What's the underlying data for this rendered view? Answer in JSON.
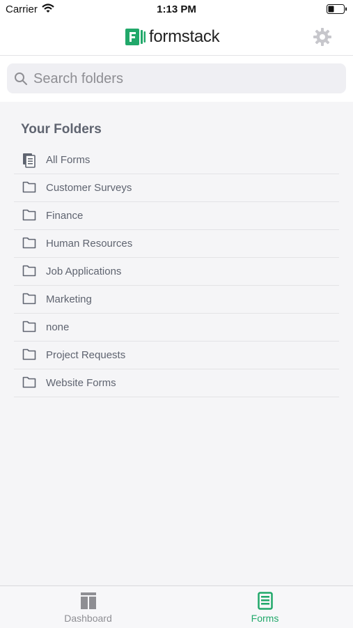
{
  "status_bar": {
    "carrier": "Carrier",
    "time": "1:13 PM"
  },
  "header": {
    "app_name": "formstack",
    "brand_color": "#21a86a"
  },
  "search": {
    "placeholder": "Search folders",
    "value": ""
  },
  "folders": {
    "title": "Your Folders",
    "items": [
      {
        "label": "All Forms",
        "icon": "forms-stack-icon"
      },
      {
        "label": "Customer Surveys",
        "icon": "folder-icon"
      },
      {
        "label": "Finance",
        "icon": "folder-icon"
      },
      {
        "label": "Human Resources",
        "icon": "folder-icon"
      },
      {
        "label": "Job Applications",
        "icon": "folder-icon"
      },
      {
        "label": "Marketing",
        "icon": "folder-icon"
      },
      {
        "label": "none",
        "icon": "folder-icon"
      },
      {
        "label": "Project Requests",
        "icon": "folder-icon"
      },
      {
        "label": "Website Forms",
        "icon": "folder-icon"
      }
    ]
  },
  "tab_bar": {
    "tabs": [
      {
        "label": "Dashboard",
        "icon": "dashboard-icon",
        "active": false
      },
      {
        "label": "Forms",
        "icon": "forms-icon",
        "active": true
      }
    ]
  }
}
